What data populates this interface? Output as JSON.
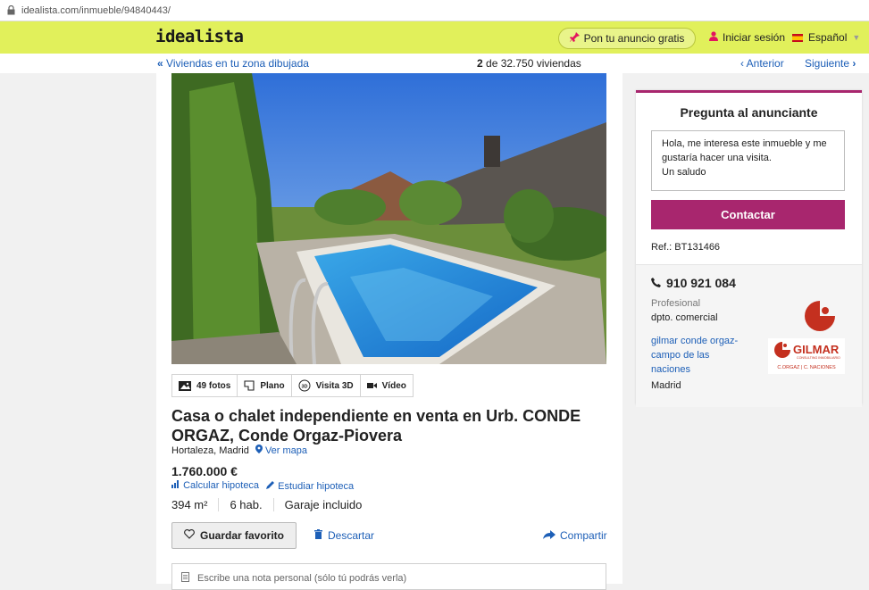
{
  "browser": {
    "url": "idealista.com/inmueble/94840443/"
  },
  "header": {
    "logo": "idealista",
    "publish_label": "Pon tu anuncio gratis",
    "login_label": "Iniciar sesión",
    "language_label": "Español"
  },
  "nav": {
    "back_label": "Viviendas en tu zona dibujada",
    "count_current": "2",
    "count_rest": " de 32.750 viviendas",
    "prev_label": "Anterior",
    "next_label": "Siguiente"
  },
  "media": {
    "photos_label": "49 fotos",
    "plan_label": "Plano",
    "tour_label": "Visita 3D",
    "video_label": "Vídeo"
  },
  "listing": {
    "title": "Casa o chalet independiente en venta en Urb. CONDE ORGAZ, Conde Orgaz-Piovera",
    "location": "Hortaleza, Madrid",
    "map_link": "Ver mapa",
    "price": "1.760.000 €",
    "mortgage_calc": "Calcular hipoteca",
    "mortgage_study": "Estudiar hipoteca",
    "features": [
      "394 m²",
      "6 hab.",
      "Garaje incluido"
    ],
    "favorite_label": "Guardar favorito",
    "discard_label": "Descartar",
    "share_label": "Compartir",
    "note_placeholder": "Escribe una nota personal (sólo tú podrás verla)"
  },
  "contact": {
    "title": "Pregunta al anunciante",
    "message": "Hola, me interesa este inmueble y me\ngustaría hacer una visita.\nUn saludo",
    "button_label": "Contactar",
    "ref": "Ref.: BT131466",
    "phone": "910 921 084",
    "type": "Profesional",
    "department": "dpto. comercial",
    "agency_name": "gilmar conde orgaz-campo de las naciones",
    "city": "Madrid",
    "agency_logo_text": "GILMAR",
    "agency_logo_sub1": "CONSULTING INMOBILIARIO",
    "agency_logo_sub2": "C.ORGAZ | C. NACIONES"
  },
  "colors": {
    "header_bg": "#e1f05b",
    "accent": "#a8266e",
    "link": "#1d5fb7",
    "pink": "#e2155f"
  }
}
